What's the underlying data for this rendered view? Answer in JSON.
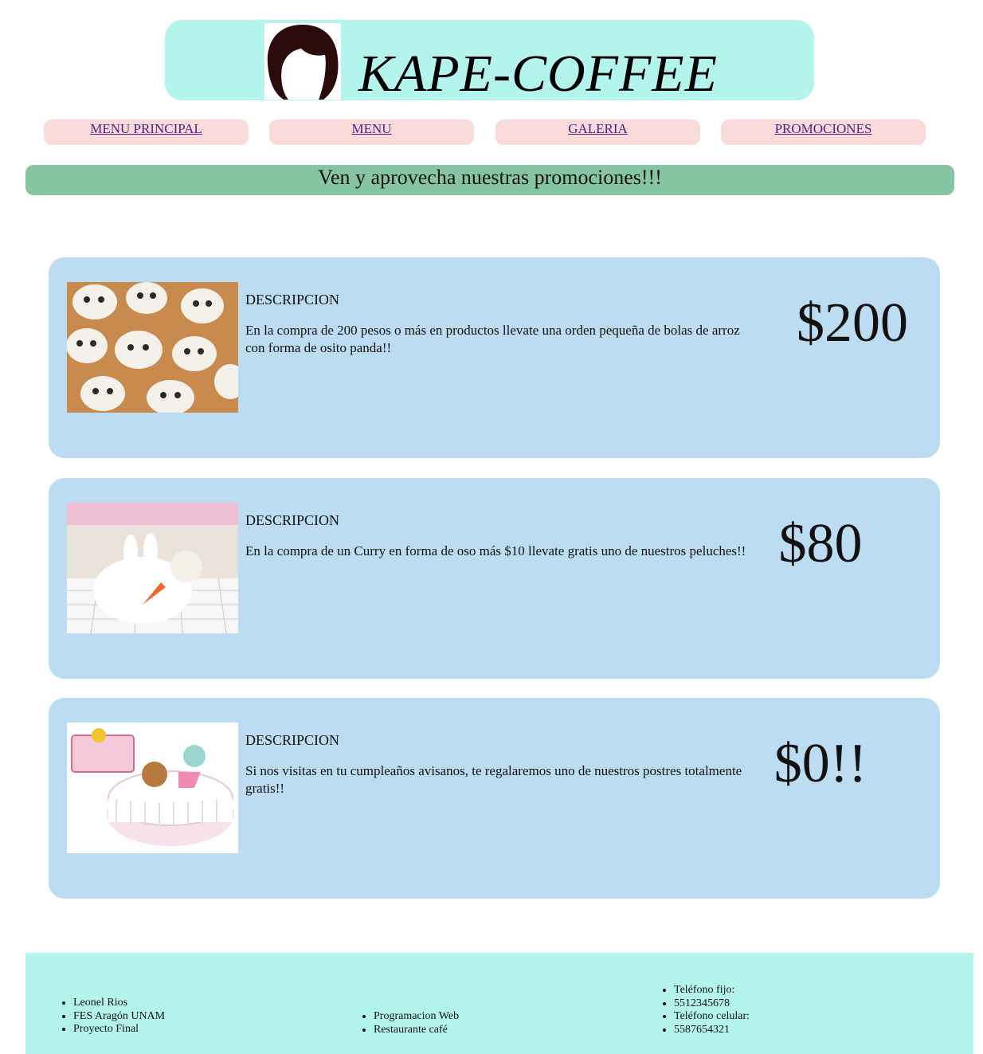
{
  "header": {
    "brand": "KAPE-COFFEE"
  },
  "nav": {
    "items": [
      {
        "label": "MENU PRINCIPAL"
      },
      {
        "label": "MENU"
      },
      {
        "label": "GALERIA"
      },
      {
        "label": "PROMOCIONES"
      }
    ]
  },
  "banner": {
    "text": "Ven y aprovecha nuestras promociones!!!"
  },
  "promos": [
    {
      "title": "DESCRIPCION",
      "description": "En la compra de 200 pesos o más en productos llevate una orden pequeña de bolas de arroz con forma de osito panda!!",
      "price": "$200"
    },
    {
      "title": "DESCRIPCION",
      "description": "En la compra de un Curry en forma de oso más $10 llevate gratis uno de nuestros peluches!!",
      "price": "$80"
    },
    {
      "title": "DESCRIPCION",
      "description": "Si nos visitas en tu cumpleaños avisanos, te regalaremos uno de nuestros postres totalmente gratis!!",
      "price": "$0!!"
    }
  ],
  "footer": {
    "col1": [
      "Leonel Rios",
      "FES Aragón UNAM",
      "Proyecto Final"
    ],
    "col2": [
      "Programacion Web",
      "Restaurante café"
    ],
    "col3": [
      "Teléfono fijo:",
      "5512345678",
      "Teléfono celular:",
      "5587654321"
    ]
  },
  "colors": {
    "header_bg": "#b3f5ec",
    "nav_bg": "#f9dcd9",
    "banner_bg": "#85c5a2",
    "card_bg": "#bcdcf2",
    "link": "#551a8b"
  },
  "icons": {
    "logo": "hair-silhouette-logo",
    "promo1_image": "panda-rice-balls-photo",
    "promo2_image": "bunny-plush-photo",
    "promo3_image": "birthday-cake-photo"
  }
}
